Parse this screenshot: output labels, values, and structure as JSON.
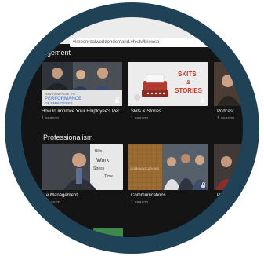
{
  "browser": {
    "url": "vimeonrealworldondemand.vhx.tv/browse"
  },
  "rows": [
    {
      "title": "agement",
      "cards": [
        {
          "title": "How to Improve Your Employee's Per…",
          "sub": "1 season",
          "thumb_text": "HOW TO IMPROVE THE PERFORMANCE OF EMPLOYEES"
        },
        {
          "title": "Skits & Stories",
          "sub": "1 season",
          "thumb_text": "SKITS & STORIES"
        },
        {
          "title": "Podcast",
          "sub": "1 season"
        }
      ]
    },
    {
      "title": "Professionalism",
      "cards": [
        {
          "title": "e Management",
          "sub": "season",
          "thumb_text": "Work"
        },
        {
          "title": "Communications",
          "sub": "1 season",
          "thumb_text": "COMMUNICATIONS"
        },
        {
          "title": "Pr",
          "sub": ""
        }
      ]
    }
  ],
  "colors": {
    "ring": "#1f4257",
    "background": "#141414",
    "skits_card": "#ececec",
    "skits_text": "#c0392b",
    "performance_banner": "#6b8fc4"
  }
}
